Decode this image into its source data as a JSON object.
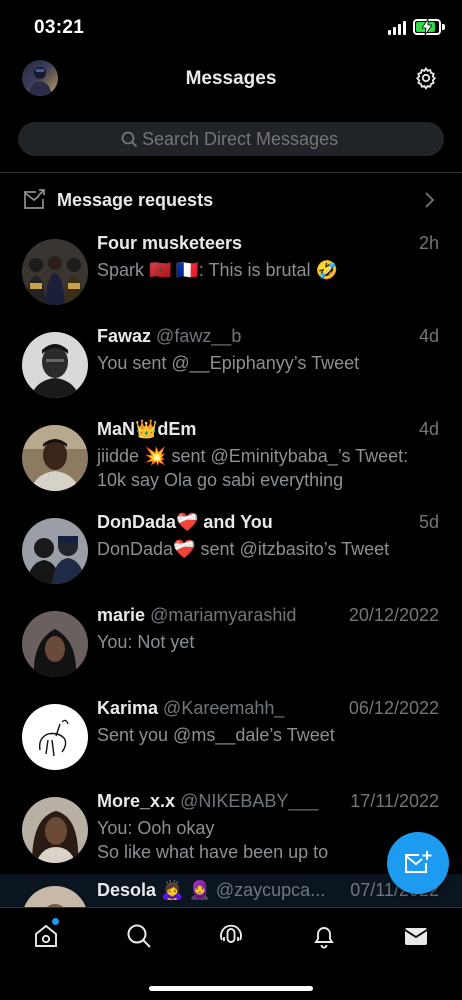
{
  "status_bar": {
    "time": "03:21",
    "battery_color": "#32d74b",
    "battery_fill_pct": 85
  },
  "header": {
    "title": "Messages",
    "avatar_icon": "profile-avatar",
    "settings_icon": "gear-icon"
  },
  "search": {
    "placeholder": "Search Direct Messages"
  },
  "requests": {
    "label": "Message requests",
    "icon": "envelope-arrow-icon"
  },
  "conversations": [
    {
      "name": "Four musketeers",
      "handle": "",
      "time": "2h",
      "preview": [
        "Spark 🇲🇦 🇫🇷: This is brutal 🤣"
      ]
    },
    {
      "name": "Fawaz",
      "handle": "@fawz__b",
      "time": "4d",
      "preview": [
        "You sent @__Epiphanyy’s Tweet"
      ]
    },
    {
      "name": "MaN👑dEm",
      "handle": "",
      "time": "4d",
      "preview": [
        "jiidde 💥 sent @Eminitybaba_’s Tweet:",
        "10k say Ola go sabi everything"
      ]
    },
    {
      "name": "DonDada❤️‍🩹 and You",
      "handle": "",
      "time": "5d",
      "preview": [
        "DonDada❤️‍🩹 sent @itzbasito’s Tweet"
      ]
    },
    {
      "name": "marie",
      "handle": "@mariamyarashid",
      "time": "20/12/2022",
      "preview": [
        "You: Not yet"
      ]
    },
    {
      "name": "Karima",
      "handle": "@Kareemahh_",
      "time": "06/12/2022",
      "preview": [
        "Sent you @ms__dale’s Tweet"
      ]
    },
    {
      "name": "More_x.x",
      "handle": "@NIKEBABY___",
      "time": "17/11/2022",
      "preview": [
        "You: Ooh okay",
        "So like what have been up to"
      ]
    },
    {
      "name": "Desola 🙇‍♀️ 🧕",
      "handle": "@zaycupca...",
      "time": "07/11/2022",
      "preview": [
        ""
      ]
    }
  ],
  "fab": {
    "icon": "new-message-icon",
    "color": "#1d9bf0"
  },
  "nav": [
    {
      "name": "home-icon"
    },
    {
      "name": "search-icon"
    },
    {
      "name": "spaces-icon"
    },
    {
      "name": "notifications-icon"
    },
    {
      "name": "messages-icon"
    }
  ],
  "colors": {
    "background": "#000000",
    "text": "#e7e9ea",
    "muted": "#71767b",
    "accent": "#1d9bf0"
  }
}
